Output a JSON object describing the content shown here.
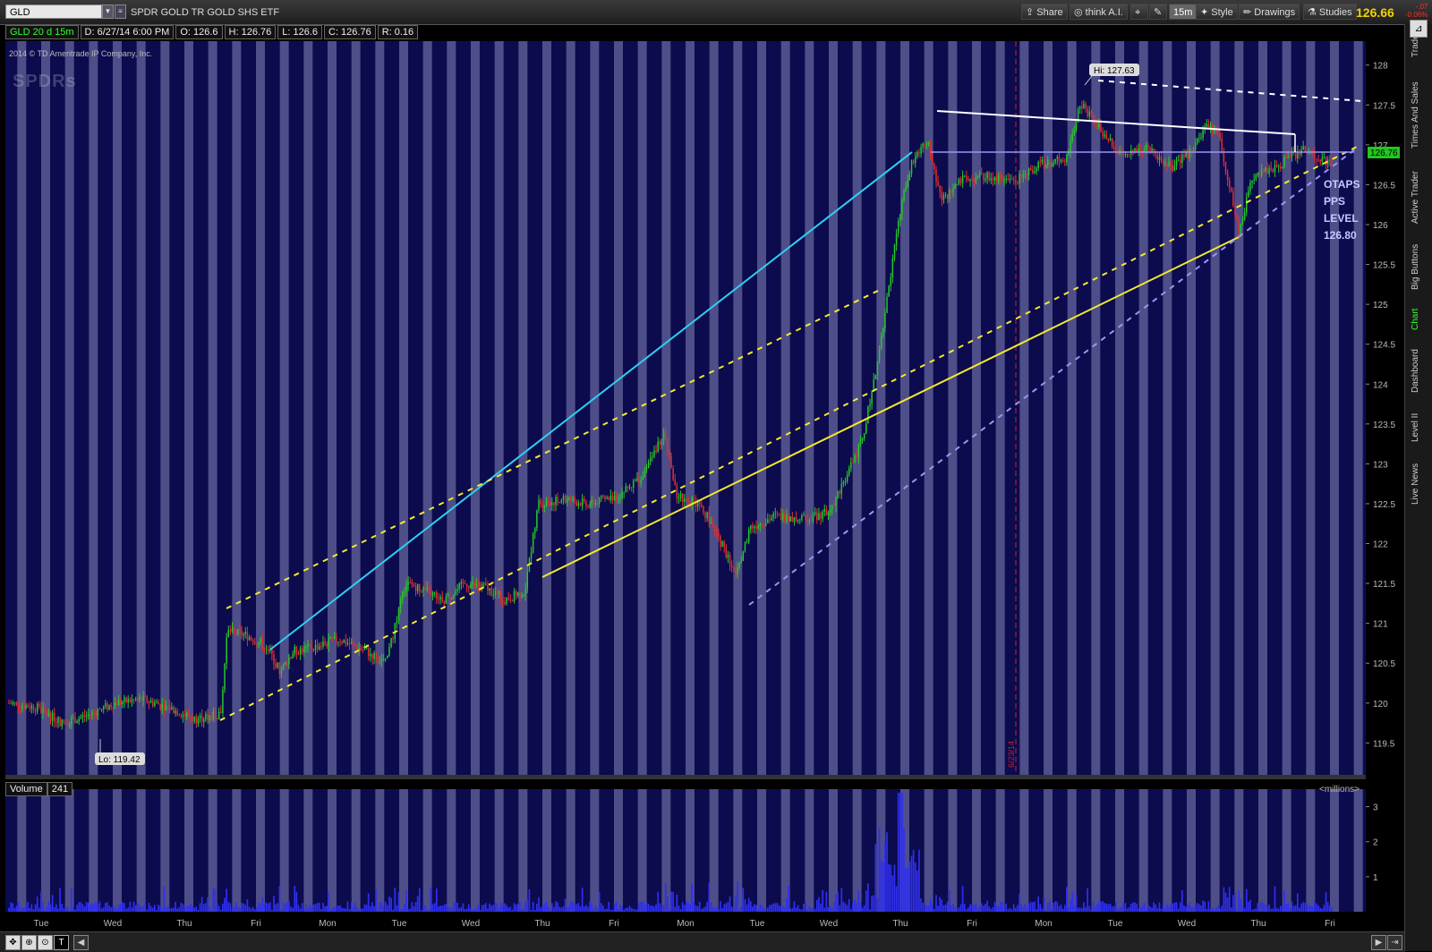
{
  "toolbar": {
    "symbol": "GLD",
    "description": "SPDR GOLD TR GOLD SHS ETF",
    "share_label": "Share",
    "think_label": "think A.I.",
    "interval_label": "15m",
    "style_label": "Style",
    "drawings_label": "Drawings",
    "studies_label": "Studies",
    "last_price": "126.66",
    "change_top": "-.07",
    "change_bottom": "-0.06%"
  },
  "info": {
    "symbol_period": "GLD 20 d 15m",
    "date": "D: 6/27/14 6:00 PM",
    "open": "O: 126.6",
    "high": "H: 126.76",
    "low": "L: 126.6",
    "close": "C: 126.76",
    "range": "R: 0.16"
  },
  "chart": {
    "copyright": "2014 © TD Ameritrade IP Company, Inc.",
    "watermark": "SPDRs",
    "hi_label": "Hi: 127.63",
    "lo_label": "Lo: 119.42",
    "current_price_tag": "126.76",
    "annotation": [
      "OTAPS",
      "PPS",
      "LEVEL",
      "126.80"
    ],
    "date_marker": "6/23/14"
  },
  "volume": {
    "label": "Volume",
    "value": "241",
    "units": "<millions>"
  },
  "side_tabs": [
    "Trade",
    "Times And Sales",
    "Active Trader",
    "Big Buttons",
    "Chart",
    "Dashboard",
    "Level II",
    "Live News"
  ],
  "colors": {
    "chart_bg": "#0b0b4e",
    "stripe": "#5a5a94",
    "up": "#28c828",
    "down": "#e03030",
    "cyan_line": "#2fd0f0",
    "yellow_line": "#f4ea2a",
    "lavender_line": "#9a96f0",
    "white_line": "#ffffff"
  },
  "chart_data": {
    "type": "candlestick",
    "price_axis": [
      "128",
      "127.5",
      "127",
      "126.5",
      "126",
      "125.5",
      "125",
      "124.5",
      "124",
      "123.5",
      "123",
      "122.5",
      "122",
      "121.5",
      "121",
      "120.5",
      "120",
      "119.5"
    ],
    "volume_axis": [
      "3",
      "2",
      "1"
    ],
    "time_axis": [
      "Tue",
      "Wed",
      "Thu",
      "Fri",
      "Mon",
      "Tue",
      "Wed",
      "Thu",
      "Fri",
      "Mon",
      "Tue",
      "Wed",
      "Thu",
      "Fri",
      "Mon",
      "Tue",
      "Wed",
      "Thu",
      "Fri"
    ],
    "ylim": [
      119.1,
      128.3
    ],
    "hi": 127.63,
    "lo": 119.42,
    "last": 126.76,
    "price_path": [
      [
        0,
        120.0
      ],
      [
        0.02,
        119.95
      ],
      [
        0.04,
        119.75
      ],
      [
        0.06,
        119.85
      ],
      [
        0.08,
        120.0
      ],
      [
        0.1,
        120.05
      ],
      [
        0.12,
        119.95
      ],
      [
        0.14,
        119.8
      ],
      [
        0.16,
        119.85
      ],
      [
        0.165,
        120.9
      ],
      [
        0.18,
        120.85
      ],
      [
        0.195,
        120.7
      ],
      [
        0.205,
        120.4
      ],
      [
        0.215,
        120.65
      ],
      [
        0.23,
        120.7
      ],
      [
        0.25,
        120.8
      ],
      [
        0.27,
        120.65
      ],
      [
        0.285,
        120.5
      ],
      [
        0.3,
        121.5
      ],
      [
        0.31,
        121.45
      ],
      [
        0.33,
        121.3
      ],
      [
        0.345,
        121.5
      ],
      [
        0.36,
        121.45
      ],
      [
        0.375,
        121.3
      ],
      [
        0.39,
        121.4
      ],
      [
        0.4,
        122.5
      ],
      [
        0.42,
        122.55
      ],
      [
        0.44,
        122.5
      ],
      [
        0.46,
        122.6
      ],
      [
        0.48,
        122.85
      ],
      [
        0.495,
        123.4
      ],
      [
        0.505,
        122.6
      ],
      [
        0.52,
        122.5
      ],
      [
        0.53,
        122.3
      ],
      [
        0.55,
        121.6
      ],
      [
        0.56,
        122.2
      ],
      [
        0.58,
        122.35
      ],
      [
        0.6,
        122.3
      ],
      [
        0.62,
        122.4
      ],
      [
        0.635,
        122.9
      ],
      [
        0.645,
        123.3
      ],
      [
        0.655,
        124.1
      ],
      [
        0.665,
        125.2
      ],
      [
        0.675,
        126.3
      ],
      [
        0.685,
        126.9
      ],
      [
        0.695,
        127.0
      ],
      [
        0.705,
        126.3
      ],
      [
        0.72,
        126.55
      ],
      [
        0.74,
        126.6
      ],
      [
        0.76,
        126.55
      ],
      [
        0.78,
        126.75
      ],
      [
        0.8,
        126.85
      ],
      [
        0.81,
        127.55
      ],
      [
        0.82,
        127.3
      ],
      [
        0.84,
        126.9
      ],
      [
        0.86,
        126.95
      ],
      [
        0.88,
        126.7
      ],
      [
        0.895,
        126.95
      ],
      [
        0.905,
        127.25
      ],
      [
        0.915,
        127.1
      ],
      [
        0.93,
        125.9
      ],
      [
        0.94,
        126.6
      ],
      [
        0.96,
        126.75
      ],
      [
        0.98,
        126.95
      ],
      [
        1.0,
        126.76
      ]
    ]
  }
}
